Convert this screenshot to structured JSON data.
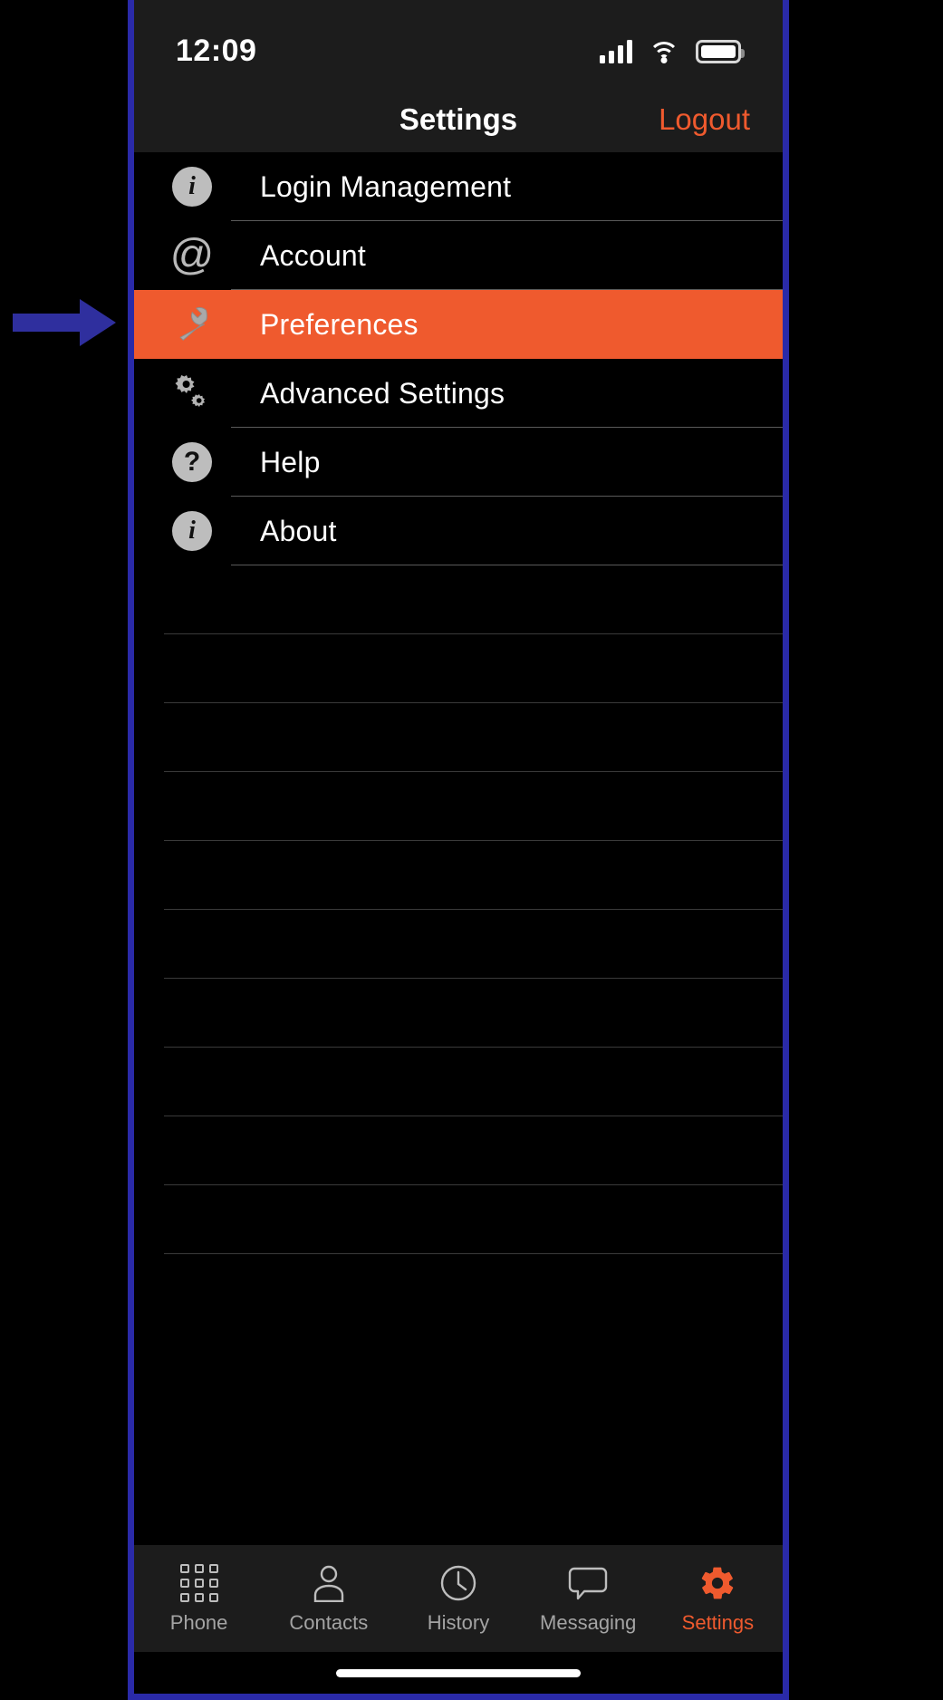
{
  "status_bar": {
    "time": "12:09",
    "signal_icon": "cellular-signal-icon",
    "wifi_icon": "wifi-icon",
    "battery_icon": "battery-full-icon"
  },
  "header": {
    "title": "Settings",
    "logout_label": "Logout",
    "logout_color": "#ef5a2e"
  },
  "settings_list": {
    "items": [
      {
        "label": "Login Management",
        "icon": "info-circle-icon",
        "selected": false
      },
      {
        "label": "Account",
        "icon": "at-sign-icon",
        "selected": false
      },
      {
        "label": "Preferences",
        "icon": "wrench-icon",
        "selected": true
      },
      {
        "label": "Advanced Settings",
        "icon": "gears-icon",
        "selected": false
      },
      {
        "label": "Help",
        "icon": "question-circle-icon",
        "selected": false
      },
      {
        "label": "About",
        "icon": "info-circle-icon",
        "selected": false
      }
    ],
    "selected_row_color": "#ef5a2e",
    "blank_row_count": 10
  },
  "tab_bar": {
    "tabs": [
      {
        "label": "Phone",
        "icon": "dialpad-icon",
        "active": false
      },
      {
        "label": "Contacts",
        "icon": "person-icon",
        "active": false
      },
      {
        "label": "History",
        "icon": "clock-icon",
        "active": false
      },
      {
        "label": "Messaging",
        "icon": "speech-bubble-icon",
        "active": false
      },
      {
        "label": "Settings",
        "icon": "gear-icon",
        "active": true
      }
    ],
    "active_color": "#ef5a2e",
    "inactive_color": "#a4a4a4"
  },
  "annotation": {
    "arrow_color": "#2f2f9e",
    "frame_border_color": "#2a2aa8"
  }
}
